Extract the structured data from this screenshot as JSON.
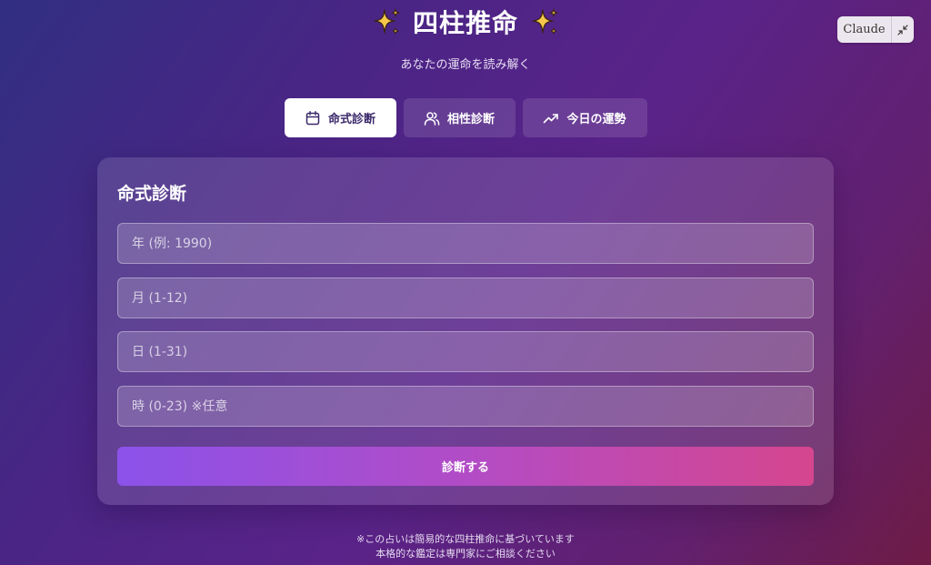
{
  "header": {
    "title": "四柱推命",
    "subtitle": "あなたの運命を読み解く",
    "left_icon": "sparkles-icon",
    "right_icon": "sparkles-icon"
  },
  "claude_chip": {
    "label": "Claude",
    "icon": "minimize-icon"
  },
  "tabs": [
    {
      "label": "命式診断",
      "icon": "calendar-icon",
      "active": true
    },
    {
      "label": "相性診断",
      "icon": "users-icon",
      "active": false
    },
    {
      "label": "今日の運勢",
      "icon": "trending-up-icon",
      "active": false
    }
  ],
  "form": {
    "title": "命式診断",
    "year_placeholder": "年 (例: 1990)",
    "month_placeholder": "月 (1-12)",
    "day_placeholder": "日 (1-31)",
    "hour_placeholder": "時 (0-23) ※任意",
    "submit_label": "診断する"
  },
  "footer": {
    "line1": "※この占いは簡易的な四柱推命に基づいています",
    "line2": "本格的な鑑定は専門家にご相談ください"
  },
  "colors": {
    "sparkle": "#f5c84b",
    "gradient_start": "#8b52ea",
    "gradient_end": "#d5468e"
  }
}
